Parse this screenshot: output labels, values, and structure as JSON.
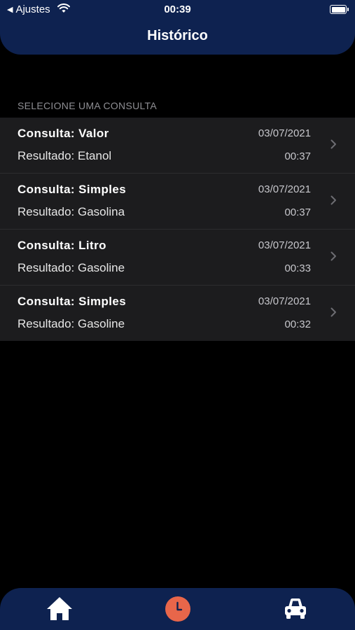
{
  "status_bar": {
    "back_app": "Ajustes",
    "time": "00:39"
  },
  "header": {
    "title": "Histórico",
    "color": "#0e2250"
  },
  "section": {
    "label": "SELECIONE UMA CONSULTA"
  },
  "history": [
    {
      "kind": "Consulta: Valor",
      "result": "Resultado: Etanol",
      "date": "03/07/2021",
      "time": "00:37"
    },
    {
      "kind": "Consulta: Simples",
      "result": "Resultado: Gasolina",
      "date": "03/07/2021",
      "time": "00:37"
    },
    {
      "kind": "Consulta: Litro",
      "result": "Resultado: Gasoline",
      "date": "03/07/2021",
      "time": "00:33"
    },
    {
      "kind": "Consulta: Simples",
      "result": "Resultado: Gasoline",
      "date": "03/07/2021",
      "time": "00:32"
    }
  ],
  "tabbar": {
    "tabs": [
      {
        "icon": "home-icon"
      },
      {
        "icon": "clock-icon",
        "active": true
      },
      {
        "icon": "car-icon"
      }
    ],
    "accent": "#e8664a"
  }
}
